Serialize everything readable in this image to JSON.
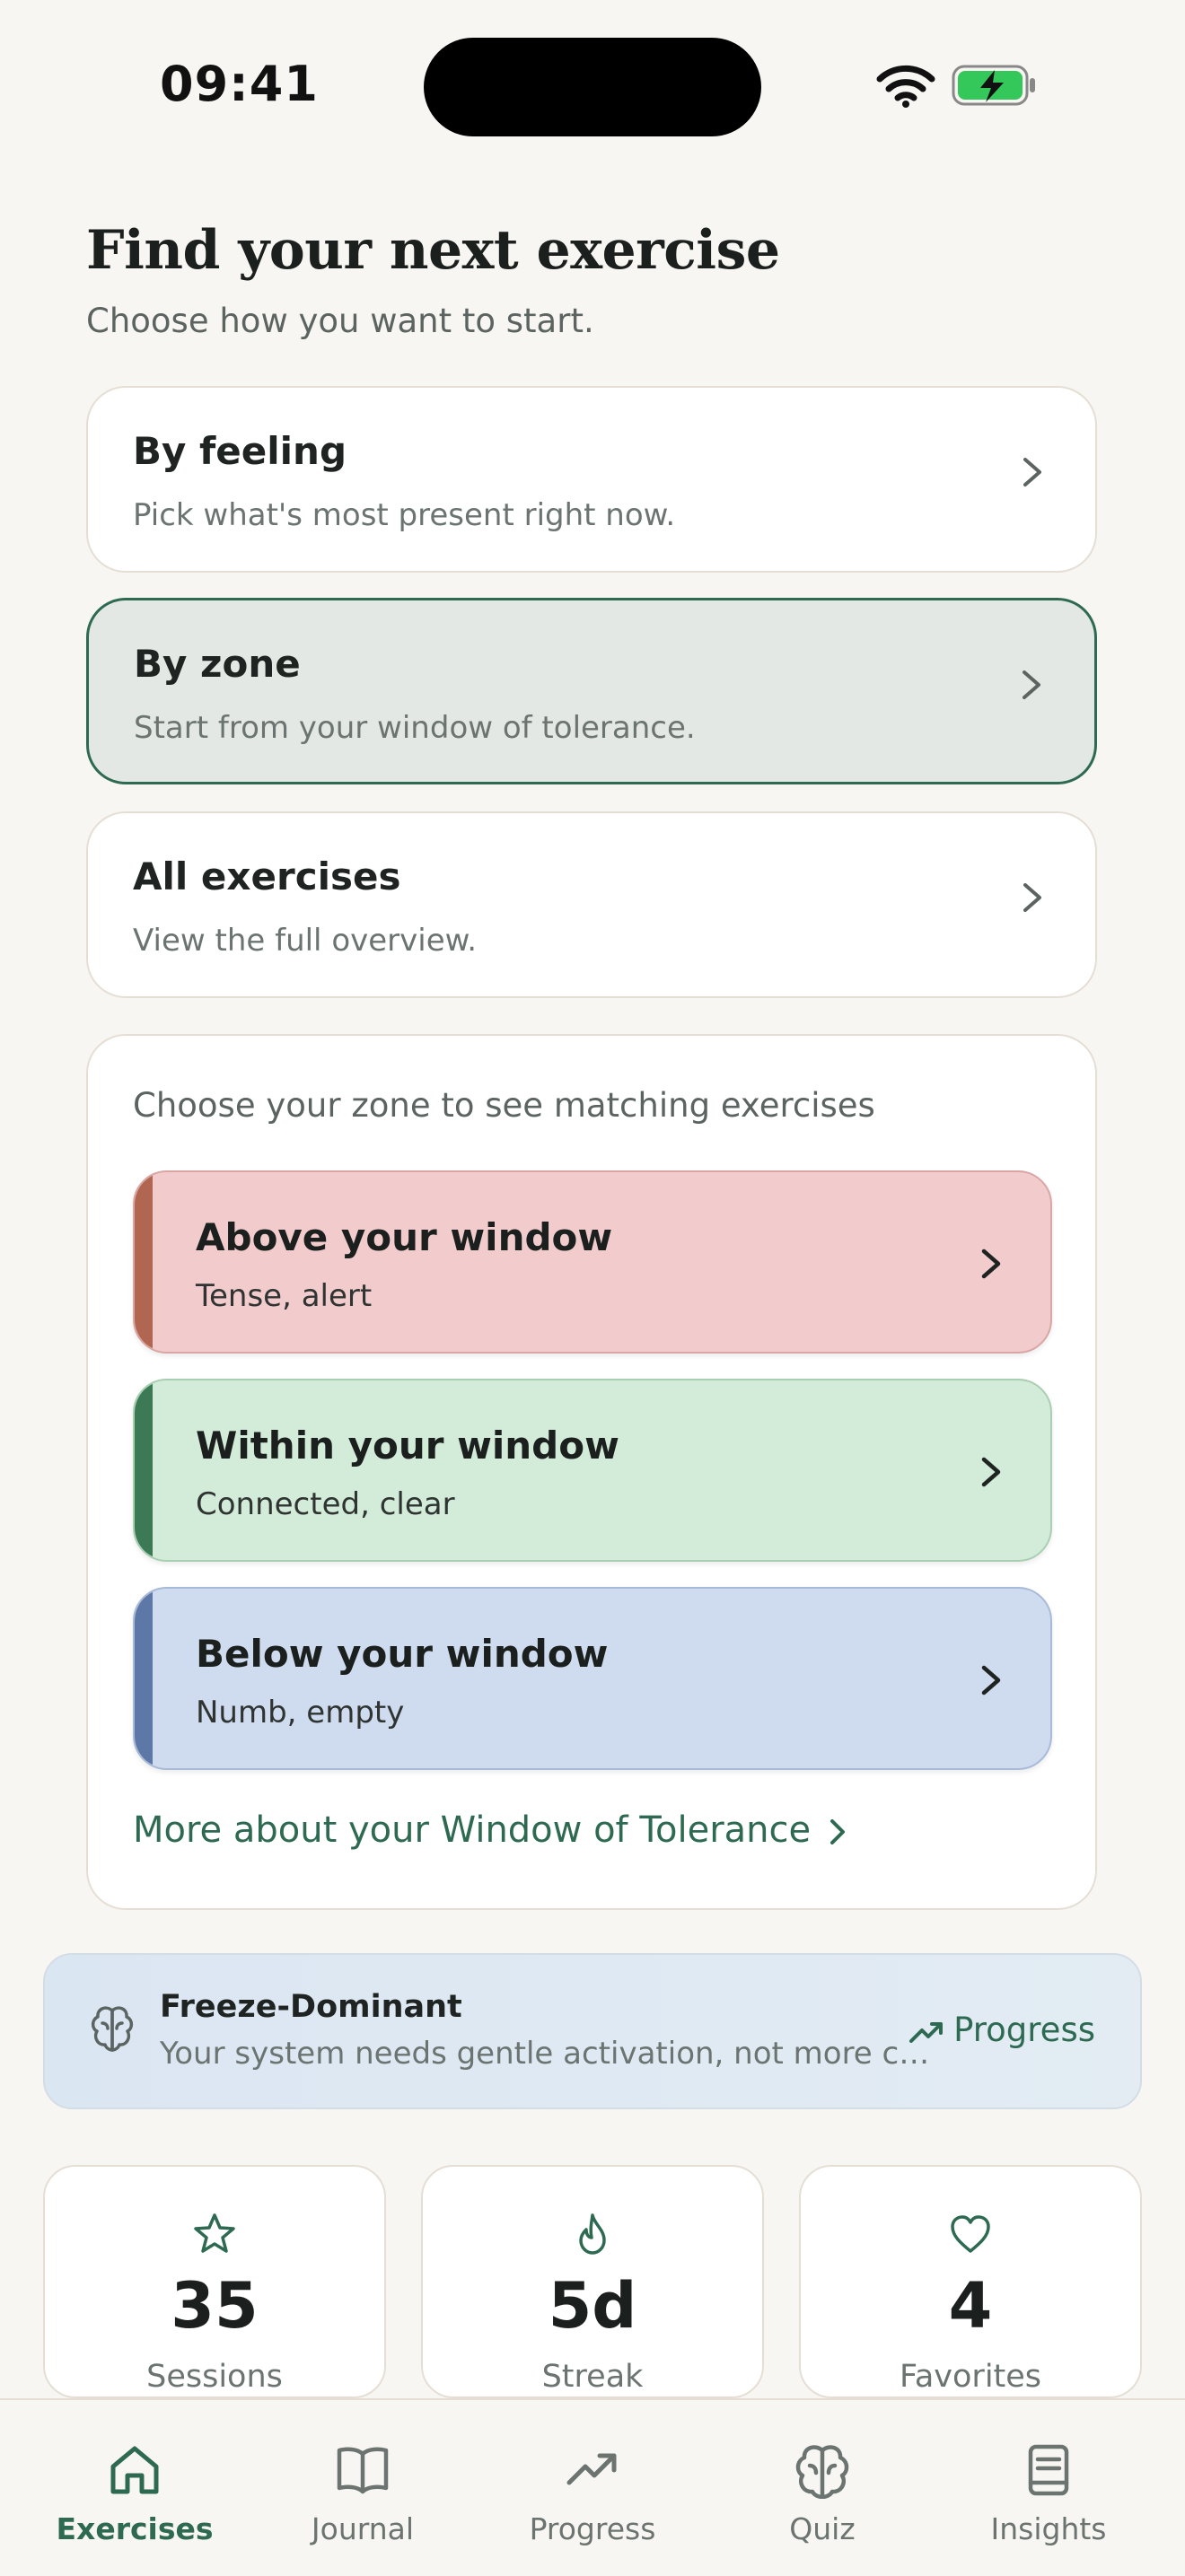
{
  "status_bar": {
    "time": "09:41"
  },
  "header": {
    "title": "Find your next exercise",
    "subtitle": "Choose how you want to start."
  },
  "options": [
    {
      "title": "By feeling",
      "desc": "Pick what's most present right now.",
      "selected": false
    },
    {
      "title": "By zone",
      "desc": "Start from your window of tolerance.",
      "selected": true
    },
    {
      "title": "All exercises",
      "desc": "View the full overview.",
      "selected": false
    }
  ],
  "zone_panel": {
    "prompt": "Choose your zone to see matching exercises",
    "zones": [
      {
        "title": "Above your window",
        "desc": "Tense, alert",
        "bg": "#f2cccc",
        "accent": "#b06650",
        "border": "#d9a6a3"
      },
      {
        "title": "Within your window",
        "desc": "Connected, clear",
        "bg": "#d3ecd9",
        "accent": "#3c7a55",
        "border": "#a9cfb2"
      },
      {
        "title": "Below your window",
        "desc": "Numb, empty",
        "bg": "#cfdcf0",
        "accent": "#5d77a6",
        "border": "#a8bad7"
      }
    ],
    "more_link": "More about your Window of Tolerance"
  },
  "profile": {
    "icon": "brain-icon",
    "name": "Freeze-Dominant",
    "desc": "Your system needs gentle activation, not more calm.",
    "link": "Progress"
  },
  "stats": [
    {
      "icon": "star-icon",
      "value": "35",
      "label": "Sessions"
    },
    {
      "icon": "flame-icon",
      "value": "5d",
      "label": "Streak"
    },
    {
      "icon": "heart-icon",
      "value": "4",
      "label": "Favorites"
    }
  ],
  "tabs": [
    {
      "icon": "home-icon",
      "label": "Exercises",
      "active": true
    },
    {
      "icon": "book-icon",
      "label": "Journal",
      "active": false
    },
    {
      "icon": "trend-icon",
      "label": "Progress",
      "active": false
    },
    {
      "icon": "brain-icon",
      "label": "Quiz",
      "active": false
    },
    {
      "icon": "notebook-icon",
      "label": "Insights",
      "active": false
    }
  ],
  "colors": {
    "accent": "#2e6a52",
    "background": "#f8f6f2",
    "selected_card": "#e3e8e4",
    "battery_fill": "#34c759"
  }
}
